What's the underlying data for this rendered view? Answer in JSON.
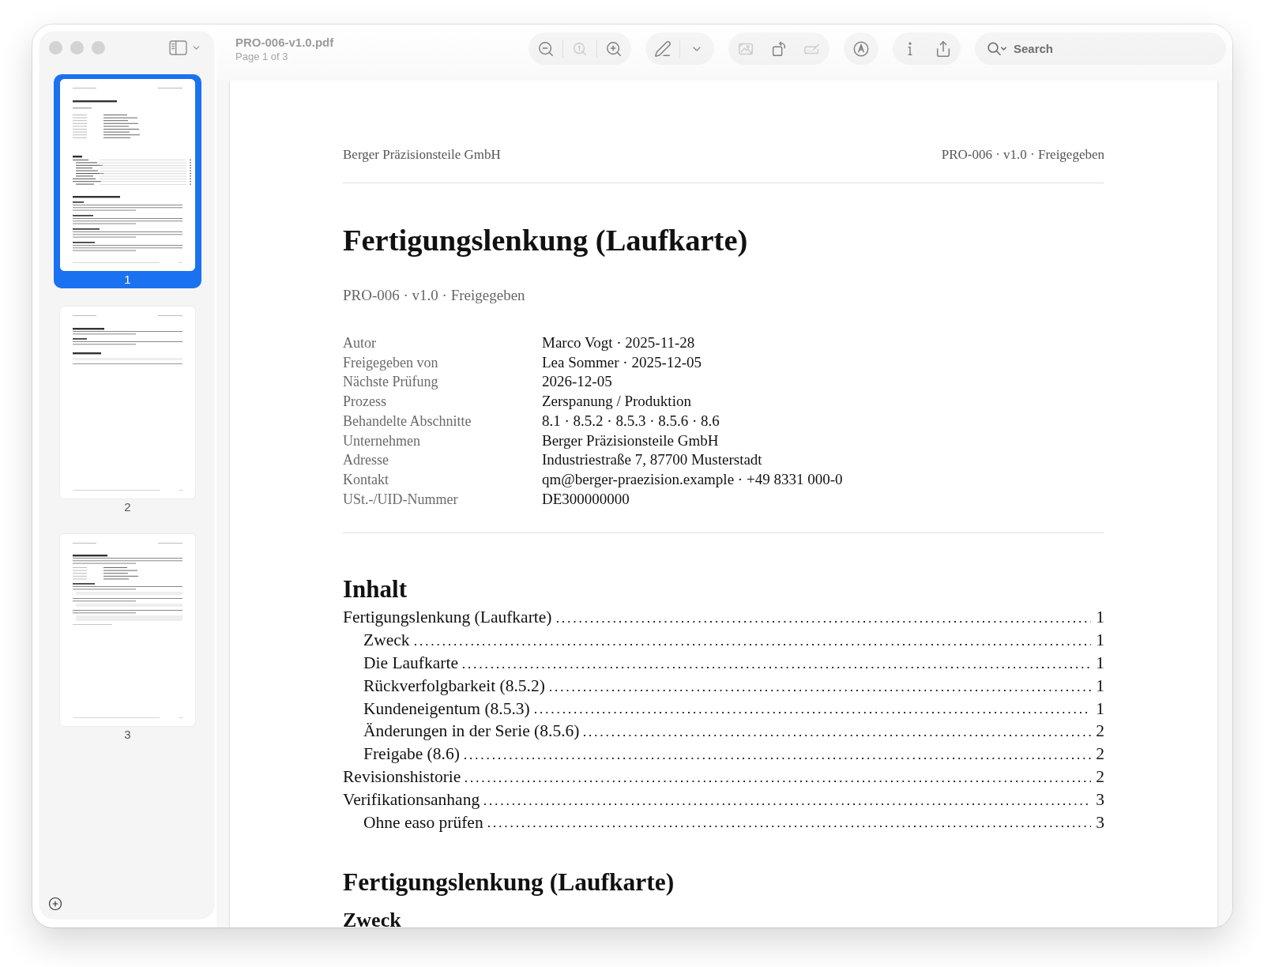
{
  "window": {
    "title": "PRO-006-v1.0.pdf",
    "subtitle": "Page 1 of 3"
  },
  "sidebar": {
    "thumbnails": [
      {
        "label": "1",
        "selected": true
      },
      {
        "label": "2",
        "selected": false
      },
      {
        "label": "3",
        "selected": false
      }
    ]
  },
  "toolbar": {
    "groups": [
      {
        "dividers": true,
        "buttons": [
          {
            "kind": "zoom-out",
            "disabled": false
          },
          {
            "kind": "actual-size",
            "disabled": true
          },
          {
            "kind": "zoom-in",
            "disabled": false
          }
        ]
      },
      {
        "dividers": true,
        "buttons": [
          {
            "kind": "highlight",
            "disabled": false
          },
          {
            "kind": "menu",
            "disabled": false
          }
        ]
      },
      {
        "dividers": false,
        "buttons": [
          {
            "kind": "crop",
            "disabled": true
          },
          {
            "kind": "rotate",
            "disabled": false
          },
          {
            "kind": "form",
            "disabled": true
          }
        ]
      },
      {
        "buttons": [
          {
            "kind": "markup",
            "disabled": false
          }
        ]
      },
      {
        "dividers": false,
        "buttons": [
          {
            "kind": "info",
            "disabled": false
          },
          {
            "kind": "share",
            "disabled": false
          }
        ]
      }
    ],
    "search": {
      "placeholder": "Search"
    }
  },
  "document": {
    "header_left": "Berger Präzisionsteile GmbH",
    "header_right": "PRO-006 · v1.0 · Freigegeben",
    "title": "Fertigungslenkung (Laufkarte)",
    "subtitle": "PRO-006 · v1.0 · Freigegeben",
    "metadata": [
      {
        "label": "Autor",
        "value": "Marco Vogt · 2025-11-28"
      },
      {
        "label": "Freigegeben von",
        "value": "Lea Sommer · 2025-12-05"
      },
      {
        "label": "Nächste Prüfung",
        "value": "2026-12-05"
      },
      {
        "label": "Prozess",
        "value": "Zerspanung / Produktion"
      },
      {
        "label": "Behandelte Abschnitte",
        "value": "8.1 · 8.5.2 · 8.5.3 · 8.5.6 · 8.6"
      },
      {
        "label": "Unternehmen",
        "value": "Berger Präzisionsteile GmbH"
      },
      {
        "label": "Adresse",
        "value": "Industriestraße 7, 87700 Musterstadt"
      },
      {
        "label": "Kontakt",
        "value": "qm@berger-praezision.example · +49 8331 000-0"
      },
      {
        "label": "USt.-/UID-Nummer",
        "value": "DE300000000"
      }
    ],
    "toc": {
      "heading": "Inhalt",
      "entries": [
        {
          "title": "Fertigungslenkung (Laufkarte)",
          "page": "1",
          "children": [
            {
              "title": "Zweck",
              "page": "1"
            },
            {
              "title": "Die Laufkarte",
              "page": "1"
            },
            {
              "title": "Rückverfolgbarkeit (8.5.2)",
              "page": "1"
            },
            {
              "title": "Kundeneigentum (8.5.3)",
              "page": "1"
            },
            {
              "title": "Änderungen in der Serie (8.5.6)",
              "page": "2"
            },
            {
              "title": "Freigabe (8.6)",
              "page": "2"
            }
          ]
        },
        {
          "title": "Revisionshistorie",
          "page": "2"
        },
        {
          "title": "Verifikationsanhang",
          "page": "3",
          "children": [
            {
              "title": "Ohne easo prüfen",
              "page": "3"
            }
          ]
        }
      ]
    },
    "section_heading": "Fertigungslenkung (Laufkarte)",
    "subsection_heading": "Zweck"
  }
}
